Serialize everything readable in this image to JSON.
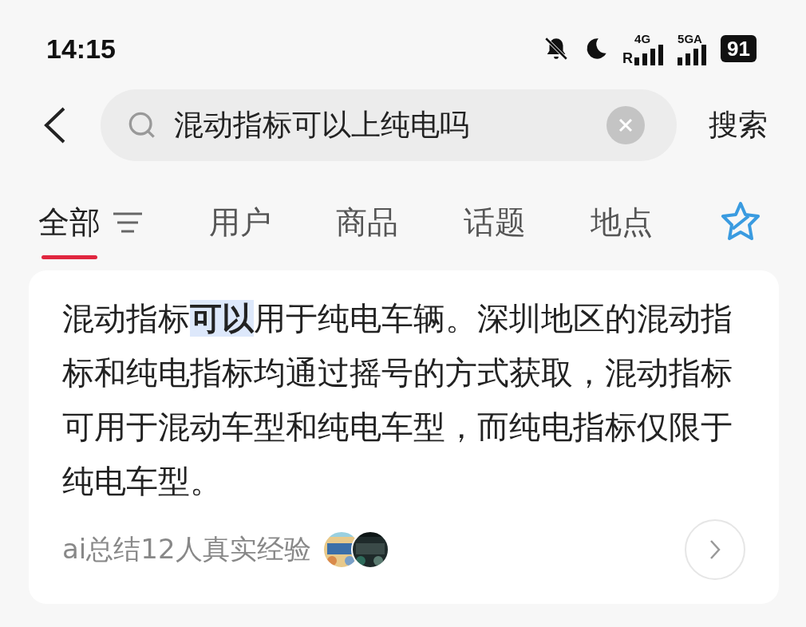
{
  "status_bar": {
    "time": "14:15",
    "network_1": {
      "type": "4G",
      "roaming": "R"
    },
    "network_2": {
      "type": "5GA"
    },
    "battery": "91"
  },
  "search": {
    "value": "混动指标可以上纯电吗",
    "button": "搜索"
  },
  "tabs": [
    {
      "label": "全部",
      "selected": true,
      "filter": true
    },
    {
      "label": "用户",
      "selected": false,
      "filter": false
    },
    {
      "label": "商品",
      "selected": false,
      "filter": false
    },
    {
      "label": "话题",
      "selected": false,
      "filter": false
    },
    {
      "label": "地点",
      "selected": false,
      "filter": false
    }
  ],
  "answer": {
    "text": "混动指标**可以**用于纯电车辆。深圳地区的混动指标和纯电指标均通过摇号的方式获取，混动指标可用于混动车型和纯电车型，而纯电指标仅限于纯电车型。",
    "source": "ai总结12人真实经验"
  }
}
